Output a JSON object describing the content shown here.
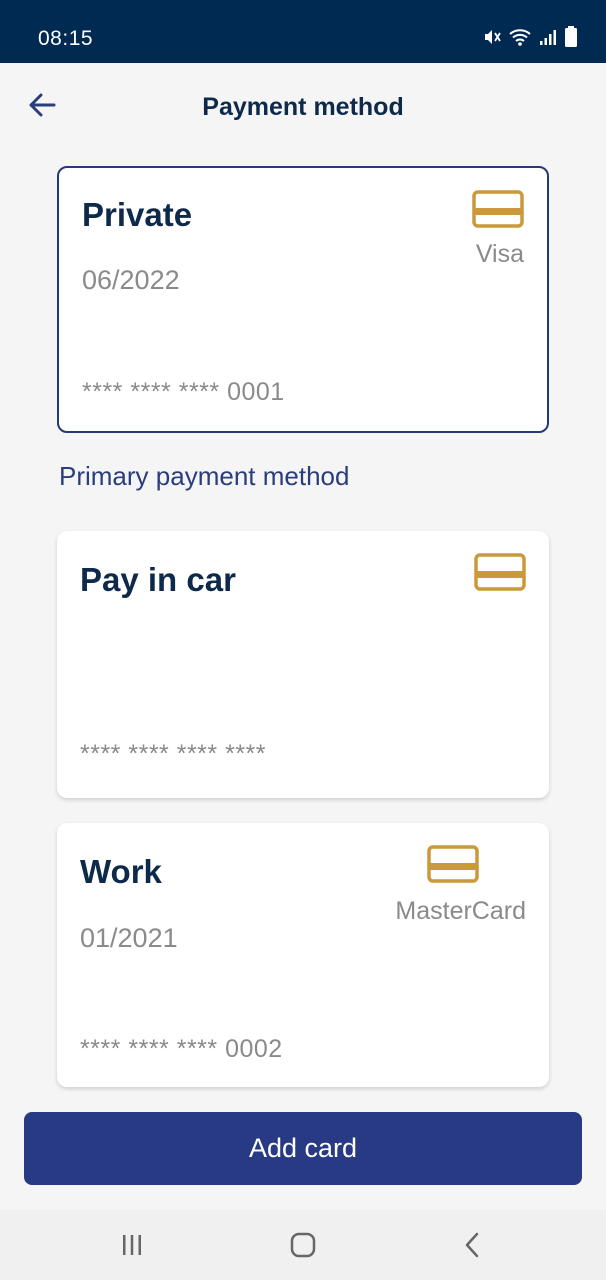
{
  "status_bar": {
    "time": "08:15",
    "icons": [
      "mute-icon",
      "wifi-icon",
      "signal-icon",
      "battery-icon"
    ]
  },
  "header": {
    "title": "Payment method",
    "back_icon": "back-arrow-icon"
  },
  "cards": [
    {
      "name": "Private",
      "expiry": "06/2022",
      "brand": "Visa",
      "number": "**** **** **** 0001",
      "selected": true,
      "icon": "credit-card-icon"
    },
    {
      "name": "Pay in car",
      "expiry": "",
      "brand": "",
      "number": "**** **** **** ****",
      "selected": false,
      "icon": "credit-card-icon"
    },
    {
      "name": "Work",
      "expiry": "01/2021",
      "brand": "MasterCard",
      "number": "**** **** **** 0002",
      "selected": false,
      "icon": "credit-card-icon"
    }
  ],
  "primary_label": "Primary payment method",
  "add_card_label": "Add card",
  "nav_bar": {
    "icons": [
      "recent-apps-icon",
      "home-icon",
      "nav-back-icon"
    ]
  },
  "colors": {
    "status_bar": "#002a52",
    "title": "#0d2a4a",
    "accent": "#293a85",
    "card_icon": "#c9993a",
    "muted_text": "#8a8a8a"
  }
}
